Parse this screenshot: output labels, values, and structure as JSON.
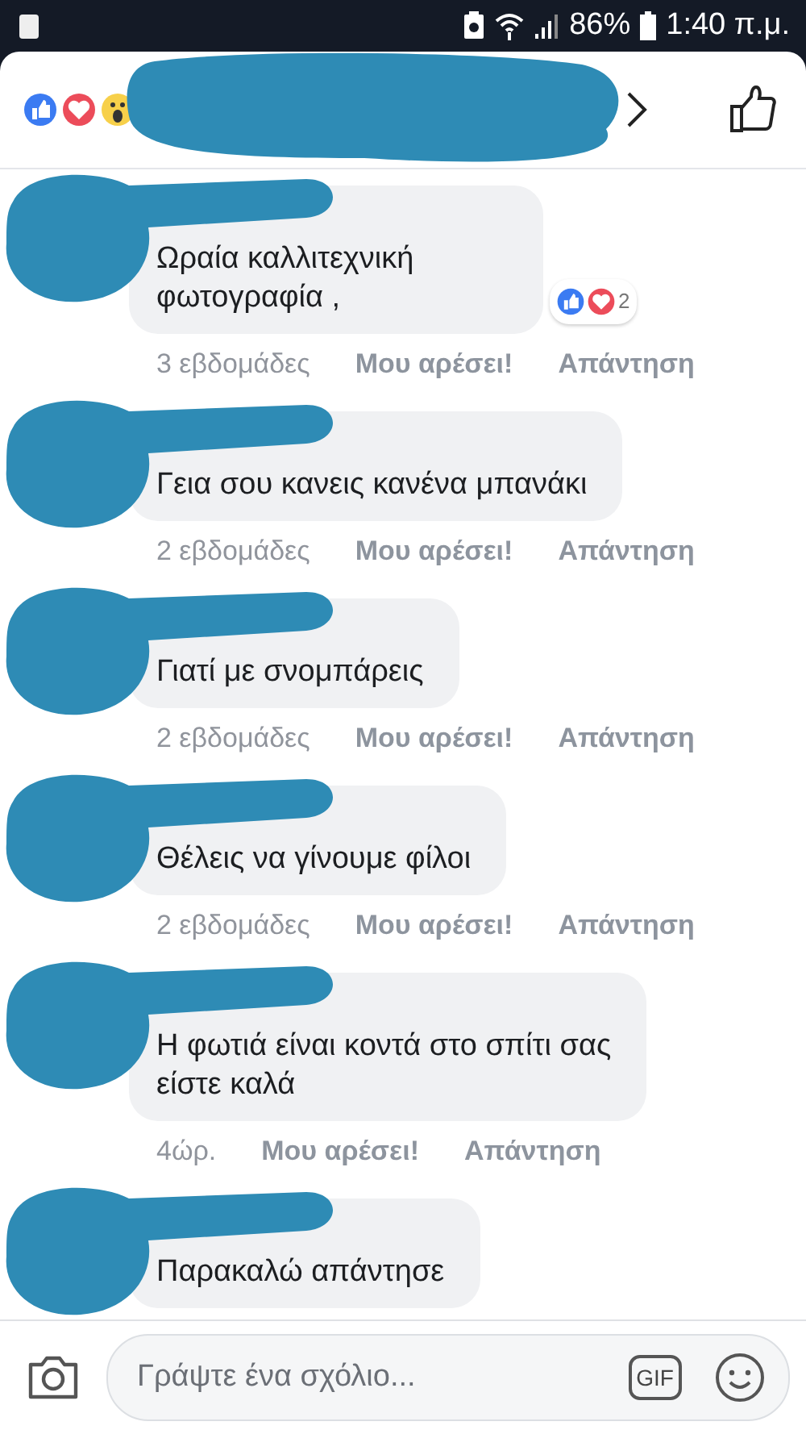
{
  "status_bar": {
    "battery": "86%",
    "time": "1:40 π.μ."
  },
  "comments": [
    {
      "text": "Ωραία καλλιτεχνική\nφωτογραφία ,",
      "time": "3 εβδομάδες",
      "like": "Μου αρέσει!",
      "reply": "Απάντηση",
      "reactions_count": "2"
    },
    {
      "text": "Γεια σου κανεις κανένα μπανάκι",
      "time": "2 εβδομάδες",
      "like": "Μου αρέσει!",
      "reply": "Απάντηση"
    },
    {
      "text": "Γιατί με σνομπάρεις",
      "time": "2 εβδομάδες",
      "like": "Μου αρέσει!",
      "reply": "Απάντηση"
    },
    {
      "text": "Θέλεις να γίνουμε φίλοι",
      "time": "2 εβδομάδες",
      "like": "Μου αρέσει!",
      "reply": "Απάντηση"
    },
    {
      "text": "Η φωτιά είναι κοντά στο σπίτι σας\nείστε καλά",
      "time": "4ώρ.",
      "like": "Μου αρέσει!",
      "reply": "Απάντηση"
    },
    {
      "text": "Παρακαλώ απάντησε"
    }
  ],
  "composer": {
    "placeholder": "Γράψτε ένα σχόλιο...",
    "gif": "GIF"
  }
}
